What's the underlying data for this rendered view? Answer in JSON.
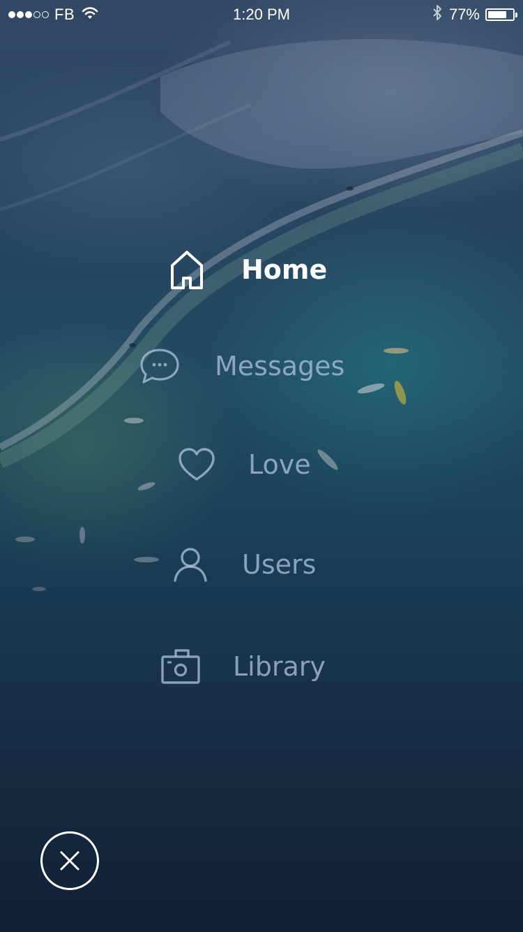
{
  "status_bar": {
    "carrier": "FB",
    "signal_bars_filled": 3,
    "signal_bars_total": 5,
    "time": "1:20 PM",
    "battery_percent": "77%",
    "battery_level": 0.77,
    "icons": [
      "wifi-icon",
      "bluetooth-icon",
      "battery-icon"
    ]
  },
  "menu": {
    "items": [
      {
        "label": "Home",
        "icon": "home-icon",
        "active": true
      },
      {
        "label": "Messages",
        "icon": "chat-bubble-icon",
        "active": false
      },
      {
        "label": "Love",
        "icon": "heart-icon",
        "active": false
      },
      {
        "label": "Users",
        "icon": "user-icon",
        "active": false
      },
      {
        "label": "Library",
        "icon": "camera-icon",
        "active": false
      }
    ]
  },
  "close_button": {
    "icon": "close-icon"
  },
  "colors": {
    "active_text": "#ffffff",
    "inactive_text": "#b0c4de",
    "background_top": "#3c5878",
    "background_bottom": "#172b44"
  }
}
